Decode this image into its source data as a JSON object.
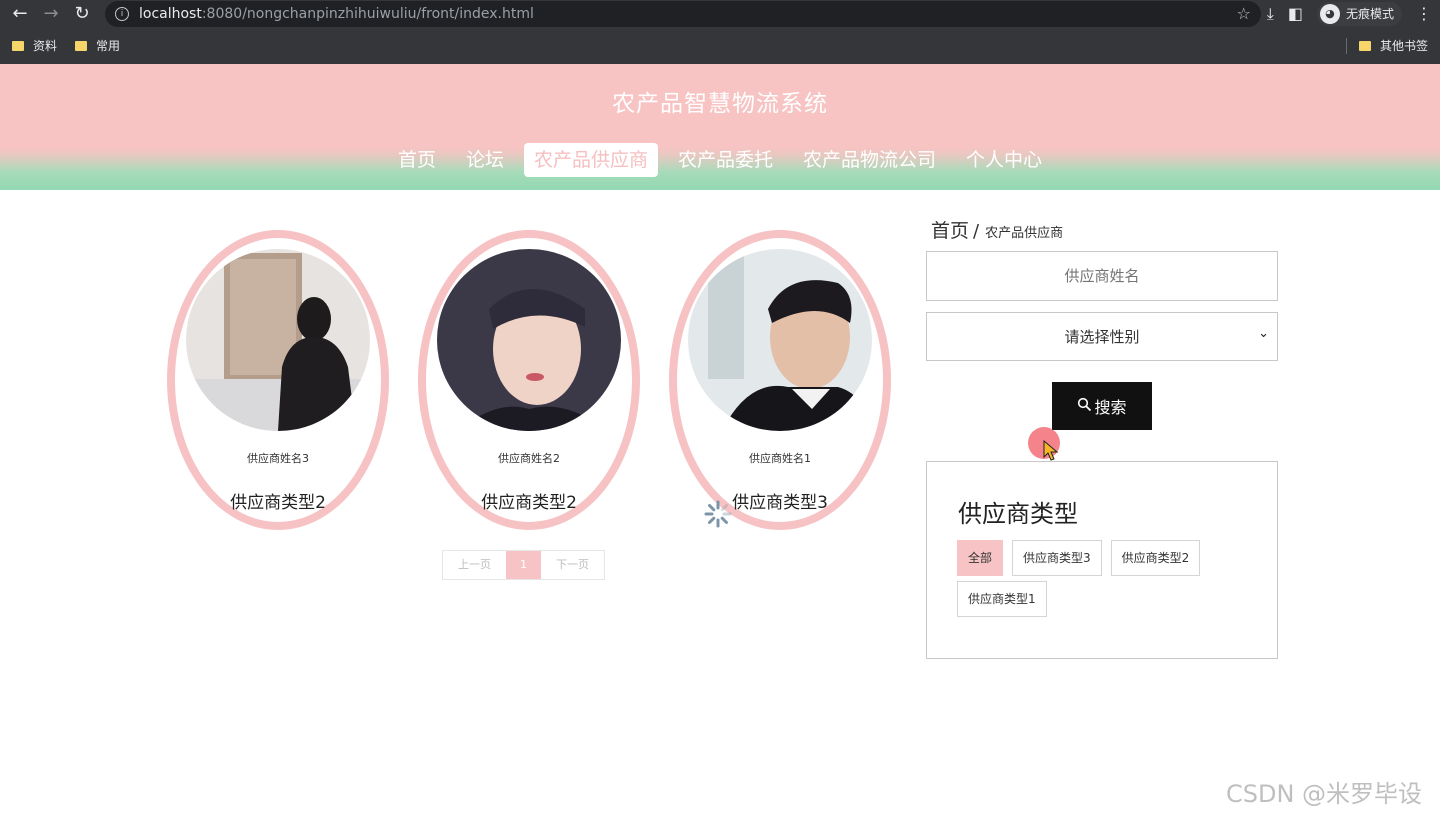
{
  "browser": {
    "url_host": "localhost",
    "url_rest": ":8080/nongchanpinzhihuiwuliu/front/index.html",
    "incognito_label": "无痕模式",
    "bookmarks": [
      "资料",
      "常用"
    ],
    "other_bookmarks": "其他书签"
  },
  "site": {
    "title": "农产品智慧物流系统",
    "nav": [
      "首页",
      "论坛",
      "农产品供应商",
      "农产品委托",
      "农产品物流公司",
      "个人中心"
    ],
    "active_nav": "农产品供应商"
  },
  "cards": [
    {
      "name": "供应商姓名3",
      "type": "供应商类型2"
    },
    {
      "name": "供应商姓名2",
      "type": "供应商类型2"
    },
    {
      "name": "供应商姓名1",
      "type": "供应商类型3"
    }
  ],
  "pager": {
    "prev": "上一页",
    "current": "1",
    "next": "下一页"
  },
  "breadcrumb": {
    "home": "首页",
    "separator": "/",
    "current": "农产品供应商"
  },
  "search": {
    "name_placeholder": "供应商姓名",
    "gender_select": "请选择性别",
    "button": "搜索"
  },
  "type_filter": {
    "title": "供应商类型",
    "tags": [
      "全部",
      "供应商类型3",
      "供应商类型2",
      "供应商类型1"
    ],
    "active": "全部"
  },
  "watermark": "CSDN @米罗毕设",
  "colors": {
    "accent_pink": "#f7c3c3",
    "accent_green": "#93d8b3"
  }
}
